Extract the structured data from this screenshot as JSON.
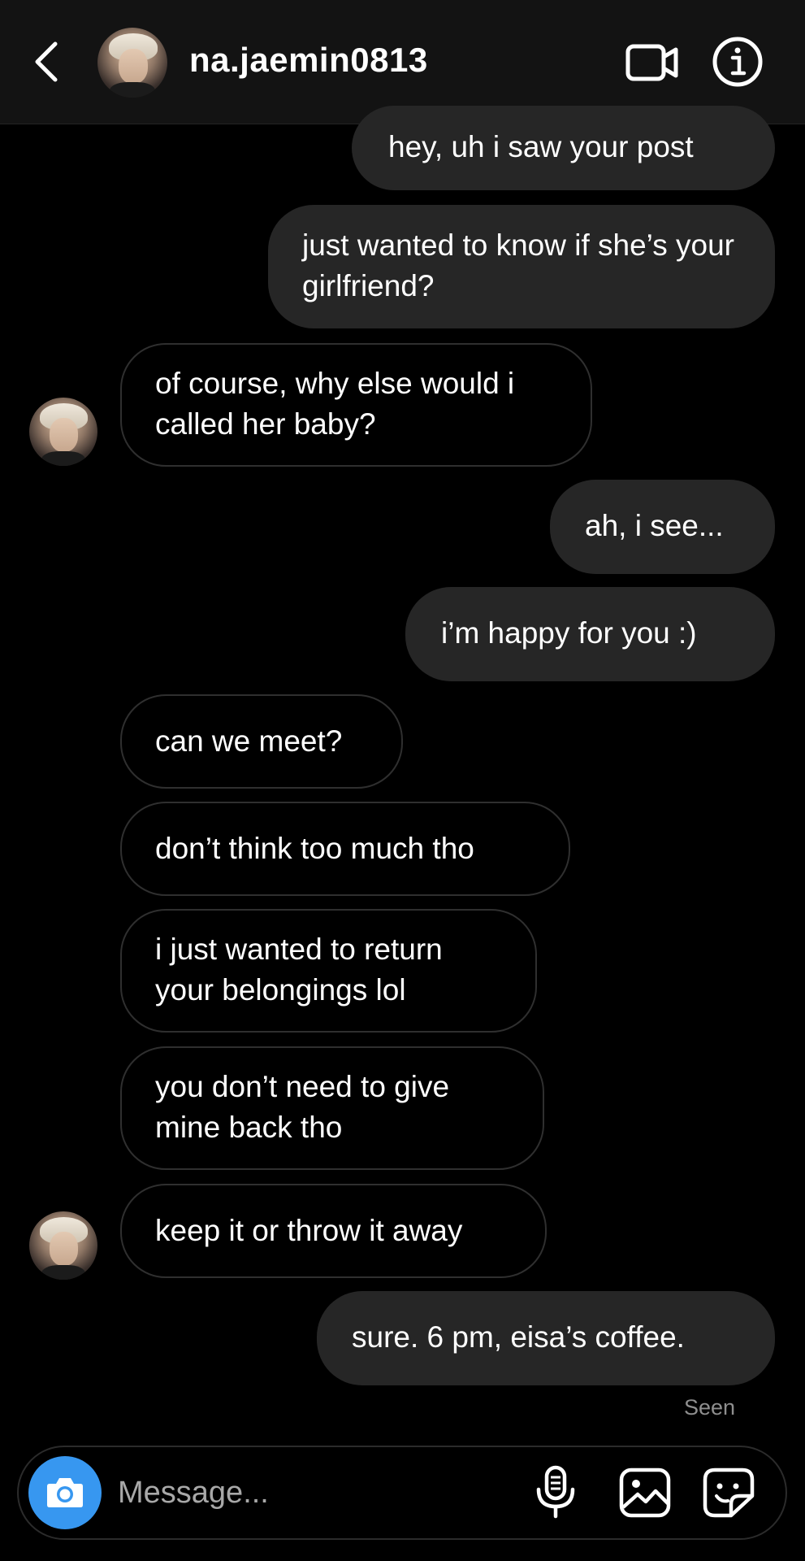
{
  "header": {
    "username": "na.jaemin0813",
    "icons": {
      "back": "chevron-left-icon",
      "video": "video-camera-icon",
      "info": "info-icon"
    }
  },
  "messages": [
    {
      "id": 1,
      "sender": "me",
      "text": "hey, uh i saw your post"
    },
    {
      "id": 2,
      "sender": "me",
      "text": "just wanted to know if she’s your girlfriend?"
    },
    {
      "id": 3,
      "sender": "them",
      "text": "of course, why else would i called her baby?",
      "avatar": true
    },
    {
      "id": 4,
      "sender": "me",
      "text": "ah, i see..."
    },
    {
      "id": 5,
      "sender": "me",
      "text": "i’m happy for you :)"
    },
    {
      "id": 6,
      "sender": "them",
      "text": "can we meet?"
    },
    {
      "id": 7,
      "sender": "them",
      "text": "don’t think too much tho"
    },
    {
      "id": 8,
      "sender": "them",
      "text": "i just wanted to return your belongings lol"
    },
    {
      "id": 9,
      "sender": "them",
      "text": "you don’t need to give mine back tho"
    },
    {
      "id": 10,
      "sender": "them",
      "text": "keep it or throw it away",
      "avatar": true
    },
    {
      "id": 11,
      "sender": "me",
      "text": "sure. 6 pm, eisa’s coffee."
    }
  ],
  "status": {
    "seen_label": "Seen"
  },
  "composer": {
    "placeholder": "Message...",
    "value": "",
    "icons": {
      "camera": "camera-icon",
      "mic": "microphone-icon",
      "gallery": "image-gallery-icon",
      "sticker": "sticker-icon"
    }
  },
  "colors": {
    "background": "#000000",
    "header": "#131313",
    "outgoing_bubble": "#262626",
    "incoming_border": "#2f2f2f",
    "accent": "#3797f0",
    "muted_text": "#8e8e8e"
  }
}
